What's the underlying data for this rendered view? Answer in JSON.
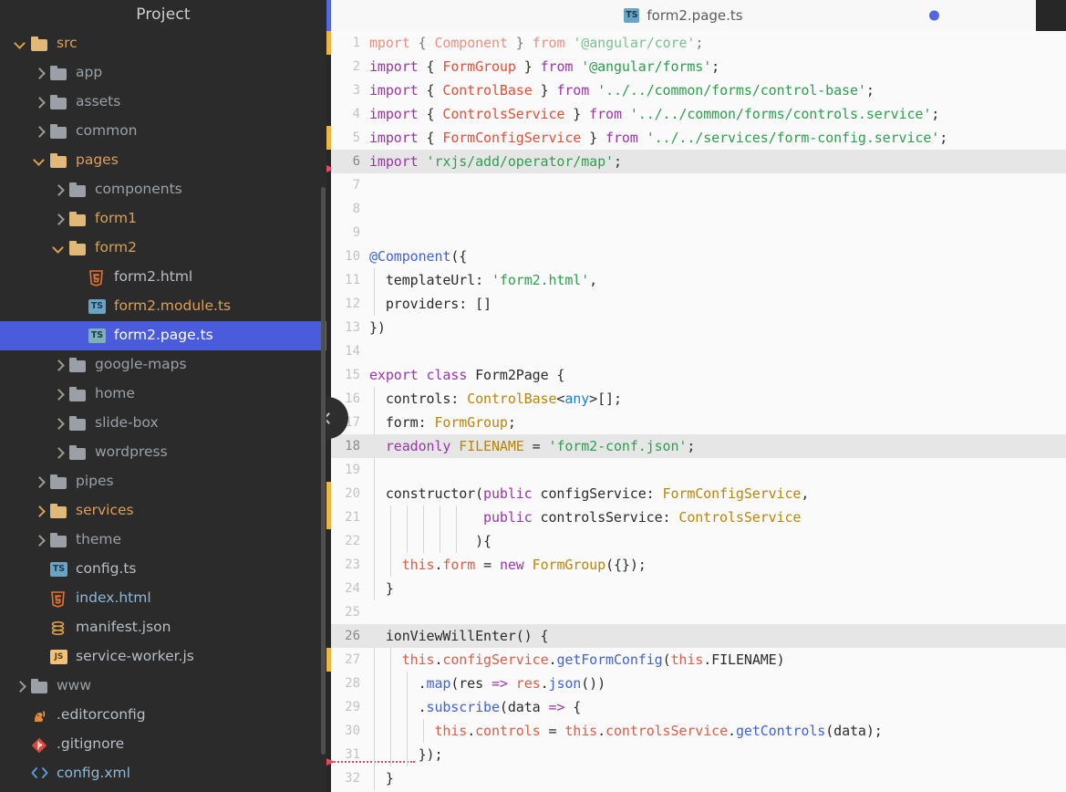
{
  "sidebar": {
    "title": "Project",
    "scrollbar": "vertical-scrollbar",
    "tree": [
      {
        "label": "src",
        "depth": 0,
        "twisty": "open",
        "icon": "folder-open",
        "color": "c-orange"
      },
      {
        "label": "app",
        "depth": 1,
        "twisty": "closed",
        "icon": "folder-plain",
        "color": "c-grey"
      },
      {
        "label": "assets",
        "depth": 1,
        "twisty": "closed",
        "icon": "folder-plain",
        "color": "c-grey"
      },
      {
        "label": "common",
        "depth": 1,
        "twisty": "closed",
        "icon": "folder-plain",
        "color": "c-grey"
      },
      {
        "label": "pages",
        "depth": 1,
        "twisty": "open",
        "icon": "folder-open",
        "color": "c-orange"
      },
      {
        "label": "components",
        "depth": 2,
        "twisty": "closed",
        "icon": "folder-plain",
        "color": "c-grey"
      },
      {
        "label": "form1",
        "depth": 2,
        "twisty": "closed",
        "icon": "folder-open",
        "color": "c-orange"
      },
      {
        "label": "form2",
        "depth": 2,
        "twisty": "open",
        "icon": "folder-open",
        "color": "c-orange"
      },
      {
        "label": "form2.html",
        "depth": 3,
        "twisty": "none",
        "icon": "html5-icon",
        "color": "c-litegr"
      },
      {
        "label": "form2.module.ts",
        "depth": 3,
        "twisty": "none",
        "icon": "typescript-icon",
        "color": "c-orange"
      },
      {
        "label": "form2.page.ts",
        "depth": 3,
        "twisty": "none",
        "icon": "typescript-icon",
        "color": "c-litegr",
        "selected": true
      },
      {
        "label": "google-maps",
        "depth": 2,
        "twisty": "closed",
        "icon": "folder-plain",
        "color": "c-grey"
      },
      {
        "label": "home",
        "depth": 2,
        "twisty": "closed",
        "icon": "folder-plain",
        "color": "c-grey"
      },
      {
        "label": "slide-box",
        "depth": 2,
        "twisty": "closed",
        "icon": "folder-plain",
        "color": "c-grey"
      },
      {
        "label": "wordpress",
        "depth": 2,
        "twisty": "closed",
        "icon": "folder-plain",
        "color": "c-grey"
      },
      {
        "label": "pipes",
        "depth": 1,
        "twisty": "closed",
        "icon": "folder-plain",
        "color": "c-grey"
      },
      {
        "label": "services",
        "depth": 1,
        "twisty": "closed-accent",
        "icon": "folder-open",
        "color": "c-orange"
      },
      {
        "label": "theme",
        "depth": 1,
        "twisty": "closed",
        "icon": "folder-plain",
        "color": "c-grey"
      },
      {
        "label": "config.ts",
        "depth": 1,
        "twisty": "none",
        "icon": "typescript-icon",
        "color": "c-litegr"
      },
      {
        "label": "index.html",
        "depth": 1,
        "twisty": "none",
        "icon": "html5-icon",
        "color": "c-blue"
      },
      {
        "label": "manifest.json",
        "depth": 1,
        "twisty": "none",
        "icon": "json-icon",
        "color": "c-litegr"
      },
      {
        "label": "service-worker.js",
        "depth": 1,
        "twisty": "none",
        "icon": "javascript-icon",
        "color": "c-litegr"
      },
      {
        "label": "www",
        "depth": 0,
        "twisty": "closed",
        "icon": "folder-plain",
        "color": "c-grey"
      },
      {
        "label": ".editorconfig",
        "depth": 0,
        "twisty": "none",
        "icon": "editorconfig-icon",
        "color": "c-litegr"
      },
      {
        "label": ".gitignore",
        "depth": 0,
        "twisty": "none",
        "icon": "git-icon",
        "color": "c-litegr"
      },
      {
        "label": "config.xml",
        "depth": 0,
        "twisty": "none",
        "icon": "xml-icon",
        "color": "c-blue"
      }
    ]
  },
  "editor": {
    "tab": {
      "filename": "form2.page.ts",
      "icon": "typescript-icon",
      "dirty_indicator": "unsaved-dot",
      "accent_color": "#5566e0"
    },
    "collapse_button": "collapse-panel-chevron",
    "highlighted_lines": [
      6,
      18,
      26
    ],
    "change_marker_lines": [
      1,
      5,
      20,
      21,
      27
    ],
    "error_marker_lines": [
      6,
      31
    ],
    "lines": [
      {
        "n": 1,
        "tokens": [
          {
            "t": "mport",
            "c": "typ faded"
          },
          {
            "t": " ",
            "c": "pl"
          },
          {
            "t": "{",
            "c": "pl faded"
          },
          {
            "t": " ",
            "c": "pl"
          },
          {
            "t": "Component",
            "c": "typ faded"
          },
          {
            "t": " ",
            "c": "pl"
          },
          {
            "t": "}",
            "c": "pl faded"
          },
          {
            "t": " ",
            "c": "pl"
          },
          {
            "t": "from",
            "c": "typ faded"
          },
          {
            "t": " ",
            "c": "pl"
          },
          {
            "t": "'@angular/core'",
            "c": "str faded"
          },
          {
            "t": ";",
            "c": "pl faded"
          }
        ]
      },
      {
        "n": 2,
        "tokens": [
          {
            "t": "import",
            "c": "kw"
          },
          {
            "t": " { ",
            "c": "pl"
          },
          {
            "t": "FormGroup",
            "c": "typ"
          },
          {
            "t": " } ",
            "c": "pl"
          },
          {
            "t": "from",
            "c": "kw"
          },
          {
            "t": " ",
            "c": "pl"
          },
          {
            "t": "'@angular/forms'",
            "c": "str"
          },
          {
            "t": ";",
            "c": "pl"
          }
        ]
      },
      {
        "n": 3,
        "tokens": [
          {
            "t": "import",
            "c": "kw"
          },
          {
            "t": " { ",
            "c": "pl"
          },
          {
            "t": "ControlBase",
            "c": "typ"
          },
          {
            "t": " } ",
            "c": "pl"
          },
          {
            "t": "from",
            "c": "kw"
          },
          {
            "t": " ",
            "c": "pl"
          },
          {
            "t": "'../../common/forms/control-base'",
            "c": "str"
          },
          {
            "t": ";",
            "c": "pl"
          }
        ]
      },
      {
        "n": 4,
        "tokens": [
          {
            "t": "import",
            "c": "kw"
          },
          {
            "t": " { ",
            "c": "pl"
          },
          {
            "t": "ControlsService",
            "c": "typ"
          },
          {
            "t": " } ",
            "c": "pl"
          },
          {
            "t": "from",
            "c": "kw"
          },
          {
            "t": " ",
            "c": "pl"
          },
          {
            "t": "'../../common/forms/controls.service'",
            "c": "str"
          },
          {
            "t": ";",
            "c": "pl"
          }
        ]
      },
      {
        "n": 5,
        "tokens": [
          {
            "t": "import",
            "c": "kw"
          },
          {
            "t": " { ",
            "c": "pl"
          },
          {
            "t": "FormConfigService",
            "c": "typ"
          },
          {
            "t": " } ",
            "c": "pl"
          },
          {
            "t": "from",
            "c": "kw"
          },
          {
            "t": " ",
            "c": "pl"
          },
          {
            "t": "'../../services/form-config.service'",
            "c": "str"
          },
          {
            "t": ";",
            "c": "pl"
          }
        ]
      },
      {
        "n": 6,
        "tokens": [
          {
            "t": "import",
            "c": "kw"
          },
          {
            "t": " ",
            "c": "pl"
          },
          {
            "t": "'rxjs/add/operator/map'",
            "c": "str"
          },
          {
            "t": ";",
            "c": "pl"
          }
        ]
      },
      {
        "n": 7,
        "tokens": []
      },
      {
        "n": 8,
        "tokens": []
      },
      {
        "n": 9,
        "tokens": []
      },
      {
        "n": 10,
        "tokens": [
          {
            "t": "@Component",
            "c": "fn"
          },
          {
            "t": "({",
            "c": "pl"
          }
        ]
      },
      {
        "n": 11,
        "tokens": [
          {
            "t": "  templateUrl: ",
            "c": "pl"
          },
          {
            "t": "'form2.html'",
            "c": "str"
          },
          {
            "t": ",",
            "c": "pl"
          }
        ]
      },
      {
        "n": 12,
        "tokens": [
          {
            "t": "  providers: []",
            "c": "pl"
          }
        ]
      },
      {
        "n": 13,
        "tokens": [
          {
            "t": "})",
            "c": "pl"
          }
        ]
      },
      {
        "n": 14,
        "tokens": []
      },
      {
        "n": 15,
        "tokens": [
          {
            "t": "export",
            "c": "kw"
          },
          {
            "t": " ",
            "c": "pl"
          },
          {
            "t": "class",
            "c": "kw"
          },
          {
            "t": " Form2Page {",
            "c": "pl"
          }
        ]
      },
      {
        "n": 16,
        "tokens": [
          {
            "t": "  controls: ",
            "c": "pl"
          },
          {
            "t": "ControlBase",
            "c": "typ2"
          },
          {
            "t": "<",
            "c": "pl"
          },
          {
            "t": "any",
            "c": "lit"
          },
          {
            "t": ">[];",
            "c": "pl"
          }
        ]
      },
      {
        "n": 17,
        "tokens": [
          {
            "t": "  form: ",
            "c": "pl"
          },
          {
            "t": "FormGroup",
            "c": "typ2"
          },
          {
            "t": ";",
            "c": "pl"
          }
        ]
      },
      {
        "n": 18,
        "tokens": [
          {
            "t": "  ",
            "c": "pl"
          },
          {
            "t": "readonly",
            "c": "kw"
          },
          {
            "t": " ",
            "c": "pl"
          },
          {
            "t": "FILENAME",
            "c": "typ2"
          },
          {
            "t": " = ",
            "c": "pl"
          },
          {
            "t": "'form2-conf.json'",
            "c": "str"
          },
          {
            "t": ";",
            "c": "pl"
          }
        ]
      },
      {
        "n": 19,
        "tokens": []
      },
      {
        "n": 20,
        "tokens": [
          {
            "t": "  constructor(",
            "c": "pl"
          },
          {
            "t": "public",
            "c": "kw"
          },
          {
            "t": " configService: ",
            "c": "pl"
          },
          {
            "t": "FormConfigService",
            "c": "typ2"
          },
          {
            "t": ",",
            "c": "pl"
          }
        ]
      },
      {
        "n": 21,
        "tokens": [
          {
            "t": "              ",
            "c": "pl"
          },
          {
            "t": "public",
            "c": "kw"
          },
          {
            "t": " controlsService: ",
            "c": "pl"
          },
          {
            "t": "ControlsService",
            "c": "typ2"
          }
        ]
      },
      {
        "n": 22,
        "tokens": [
          {
            "t": "             ){",
            "c": "pl"
          }
        ]
      },
      {
        "n": 23,
        "tokens": [
          {
            "t": "    ",
            "c": "pl"
          },
          {
            "t": "this",
            "c": "mut"
          },
          {
            "t": ".",
            "c": "pl"
          },
          {
            "t": "form",
            "c": "mut"
          },
          {
            "t": " = ",
            "c": "pl"
          },
          {
            "t": "new",
            "c": "kw"
          },
          {
            "t": " ",
            "c": "pl"
          },
          {
            "t": "FormGroup",
            "c": "typ2"
          },
          {
            "t": "({});",
            "c": "pl"
          }
        ]
      },
      {
        "n": 24,
        "tokens": [
          {
            "t": "  }",
            "c": "pl"
          }
        ]
      },
      {
        "n": 25,
        "tokens": []
      },
      {
        "n": 26,
        "tokens": [
          {
            "t": "  ionViewWillEnter() {",
            "c": "pl"
          }
        ]
      },
      {
        "n": 27,
        "tokens": [
          {
            "t": "    ",
            "c": "pl"
          },
          {
            "t": "this",
            "c": "mut"
          },
          {
            "t": ".",
            "c": "pl"
          },
          {
            "t": "configService",
            "c": "mut"
          },
          {
            "t": ".",
            "c": "pl"
          },
          {
            "t": "getFormConfig",
            "c": "fn"
          },
          {
            "t": "(",
            "c": "pl"
          },
          {
            "t": "this",
            "c": "mut"
          },
          {
            "t": ".",
            "c": "pl"
          },
          {
            "t": "FILENAME",
            "c": "pl"
          },
          {
            "t": ")",
            "c": "pl"
          }
        ]
      },
      {
        "n": 28,
        "tokens": [
          {
            "t": "      .",
            "c": "pl"
          },
          {
            "t": "map",
            "c": "fn"
          },
          {
            "t": "(res ",
            "c": "pl"
          },
          {
            "t": "=>",
            "c": "kw"
          },
          {
            "t": " ",
            "c": "pl"
          },
          {
            "t": "res",
            "c": "mut"
          },
          {
            "t": ".",
            "c": "pl"
          },
          {
            "t": "json",
            "c": "fn"
          },
          {
            "t": "())",
            "c": "pl"
          }
        ]
      },
      {
        "n": 29,
        "tokens": [
          {
            "t": "      .",
            "c": "pl"
          },
          {
            "t": "subscribe",
            "c": "fn"
          },
          {
            "t": "(data ",
            "c": "pl"
          },
          {
            "t": "=>",
            "c": "kw"
          },
          {
            "t": " {",
            "c": "pl"
          }
        ]
      },
      {
        "n": 30,
        "tokens": [
          {
            "t": "        ",
            "c": "pl"
          },
          {
            "t": "this",
            "c": "mut"
          },
          {
            "t": ".",
            "c": "pl"
          },
          {
            "t": "controls",
            "c": "mut"
          },
          {
            "t": " = ",
            "c": "pl"
          },
          {
            "t": "this",
            "c": "mut"
          },
          {
            "t": ".",
            "c": "pl"
          },
          {
            "t": "controlsService",
            "c": "mut"
          },
          {
            "t": ".",
            "c": "pl"
          },
          {
            "t": "getControls",
            "c": "fn"
          },
          {
            "t": "(data);",
            "c": "pl"
          }
        ]
      },
      {
        "n": 31,
        "tokens": [
          {
            "t": "      });",
            "c": "pl"
          }
        ]
      },
      {
        "n": 32,
        "tokens": [
          {
            "t": "  }",
            "c": "pl"
          }
        ]
      }
    ]
  }
}
